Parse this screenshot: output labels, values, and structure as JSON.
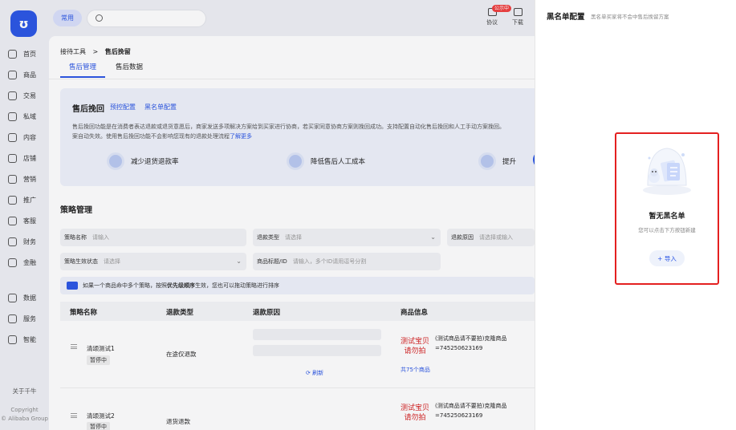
{
  "sidebar": {
    "logo": "ʊ",
    "items": [
      {
        "label": "首页",
        "icon": "home-icon"
      },
      {
        "label": "商品",
        "icon": "goods-icon"
      },
      {
        "label": "交易",
        "icon": "trade-icon"
      },
      {
        "label": "私域",
        "icon": "private-icon"
      },
      {
        "label": "内容",
        "icon": "content-icon"
      },
      {
        "label": "店铺",
        "icon": "shop-icon"
      },
      {
        "label": "营销",
        "icon": "marketing-icon"
      },
      {
        "label": "推广",
        "icon": "promotion-icon"
      },
      {
        "label": "客服",
        "icon": "service-icon"
      },
      {
        "label": "财务",
        "icon": "finance-icon"
      },
      {
        "label": "金融",
        "icon": "money-icon"
      },
      {
        "label": "数据",
        "icon": "data-icon"
      },
      {
        "label": "服务",
        "icon": "services-icon"
      },
      {
        "label": "智能",
        "icon": "ai-icon"
      }
    ],
    "about": "关于千牛",
    "copyright": "Copyright",
    "company": "© Alibaba Group"
  },
  "topbar": {
    "common_label": "常用",
    "search_placeholder": "",
    "agreement_label": "协议",
    "agreement_badge": "公示中",
    "download_label": "下载"
  },
  "main": {
    "breadcrumb_parent": "接待工具",
    "breadcrumb_sep": ">",
    "breadcrumb_current": "售后挽留",
    "tabs": [
      "售后管理",
      "售后数据"
    ],
    "card": {
      "title": "售后挽回",
      "link1": "预控配置",
      "link2": "黑名单配置",
      "desc_line1": "售后挽回功能是在消费者表达退款或退货意愿后，商家发送多项解决方案给到买家进行协商，若买家同意协商方案则挽回成功。支持配置自动化售后挽回和人工手动方案挽回。",
      "desc_line2": "案自动失效。使用售后挽回功能不会影响您现有的退款处理流程",
      "learn_more": "了解更多",
      "features": [
        "减少退货退款率",
        "降低售后人工成本",
        "提升"
      ]
    },
    "strategy_title": "策略管理",
    "filters": [
      {
        "label": "策略名称",
        "placeholder": "请输入"
      },
      {
        "label": "退款类型",
        "placeholder": "请选择"
      },
      {
        "label": "退款原因",
        "placeholder": "请选择或输入"
      },
      {
        "label": "策略生效状态",
        "placeholder": "请选择"
      },
      {
        "label": "商品标题/ID",
        "placeholder": "请输入，多个ID请用逗号分割"
      }
    ],
    "tip_pre": "如果一个商品命中多个策略，按照",
    "tip_bold": "优先级顺序",
    "tip_post": "生效，您也可以拖动策略进行排序",
    "table_headers": [
      "策略名称",
      "退款类型",
      "退款原因",
      "商品信息"
    ],
    "rows": [
      {
        "name": "清颂测试1",
        "status": "暂停中",
        "refund_type": "在途仅退款",
        "refresh": "刷新",
        "thumb_text": "测试宝贝请勿拍",
        "product": "(测试商品请不要拍)克隆商品=745250623169",
        "count": "共75个商品"
      },
      {
        "name": "清颂测试2",
        "status": "暂停中",
        "refund_type": "退货退款",
        "refresh": "",
        "thumb_text": "测试宝贝请勿拍",
        "product": "(测试商品请不要拍)克隆商品=745250623169",
        "count": ""
      }
    ]
  },
  "panel": {
    "title": "黑名单配置",
    "subtitle": "黑名单买家将不会中售后挽留方案",
    "empty_title": "暂无黑名单",
    "empty_desc": "您可以点击下方按钮新建",
    "import_label": "+ 导入",
    "highlight_color": "#e42020"
  },
  "colors": {
    "accent": "#2a55e5",
    "danger": "#e42020"
  }
}
